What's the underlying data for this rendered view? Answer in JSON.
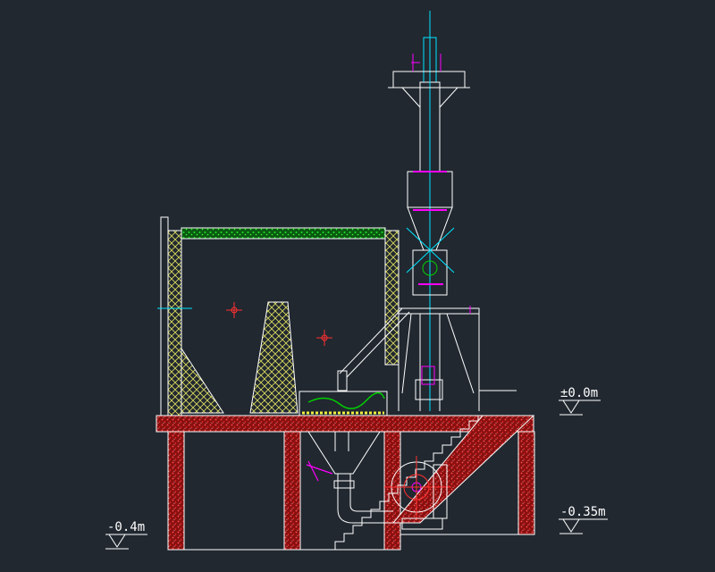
{
  "drawing": {
    "background": "#212830",
    "colors": {
      "line": "#ffffff",
      "cyan": "#00e5ff",
      "magenta": "#ff00ff",
      "red": "#ff0000",
      "green": "#00d000",
      "yellow_hatch": "#e0e060",
      "brick": "#a01818"
    },
    "elevations": [
      {
        "id": "level-plus-minus-0",
        "text": "±0.0m"
      },
      {
        "id": "level-minus-035",
        "text": "-0.35m"
      },
      {
        "id": "level-minus-04",
        "text": "-0.4m"
      }
    ]
  }
}
